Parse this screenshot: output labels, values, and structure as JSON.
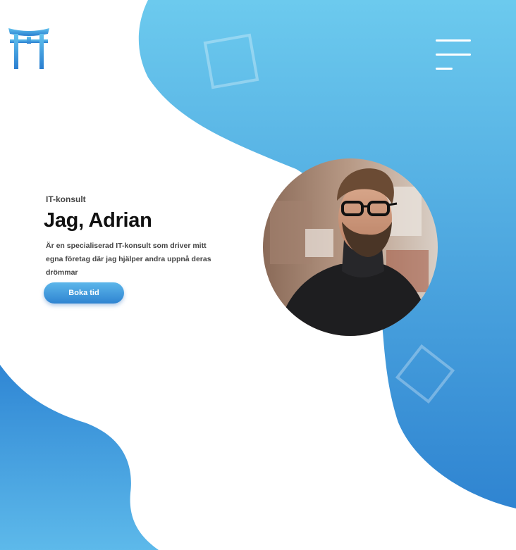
{
  "brand": {
    "logo_icon": "torii-gate-icon"
  },
  "nav": {
    "menu_icon": "hamburger-menu-icon"
  },
  "hero": {
    "eyebrow": "IT-konsult",
    "title": "Jag, Adrian",
    "description": "Är en specialiserad IT-konsult som driver mitt egna företag där jag hjälper andra uppnå deras drömmar",
    "cta_label": "Boka tid"
  },
  "colors": {
    "accent_light": "#6ccaee",
    "accent_dark": "#2f84d1",
    "text_dark": "#111111",
    "text_body": "#444444"
  }
}
